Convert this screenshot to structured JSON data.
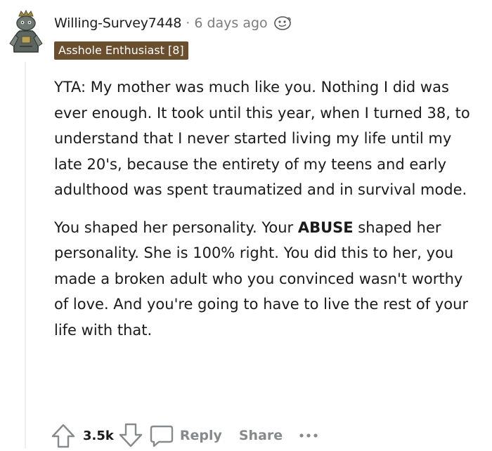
{
  "comment": {
    "author": {
      "username": "Willing-Survey7448",
      "avatar_icon": "snoo-avatar-icon"
    },
    "separator": "·",
    "timestamp": "6 days ago",
    "award_icon": "award-icon",
    "flair": "Asshole Enthusiast [8]",
    "body": {
      "paragraph_1": "YTA: My mother was much like you. Nothing I did was ever enough. It took until this year, when I turned 38, to understand that I never started living my life until my late 20's, because the entirety of my teens and early adulthood was spent traumatized and in survival mode.",
      "paragraph_2_before": "You shaped her personality. Your ",
      "paragraph_2_bold": "ABUSE",
      "paragraph_2_after": " shaped her personality. She is 100% right. You did this to her, you made a broken adult who you convinced wasn't worthy of love. And you're going to have to live the rest of your life with that."
    },
    "actions": {
      "score": "3.5k",
      "reply_label": "Reply",
      "share_label": "Share",
      "more_label": "•••"
    }
  },
  "colors": {
    "flair_bg": "#6b4e2e",
    "muted_text": "#878a8c",
    "body_text": "#1a1a1b",
    "thread_line": "#edeff1"
  }
}
